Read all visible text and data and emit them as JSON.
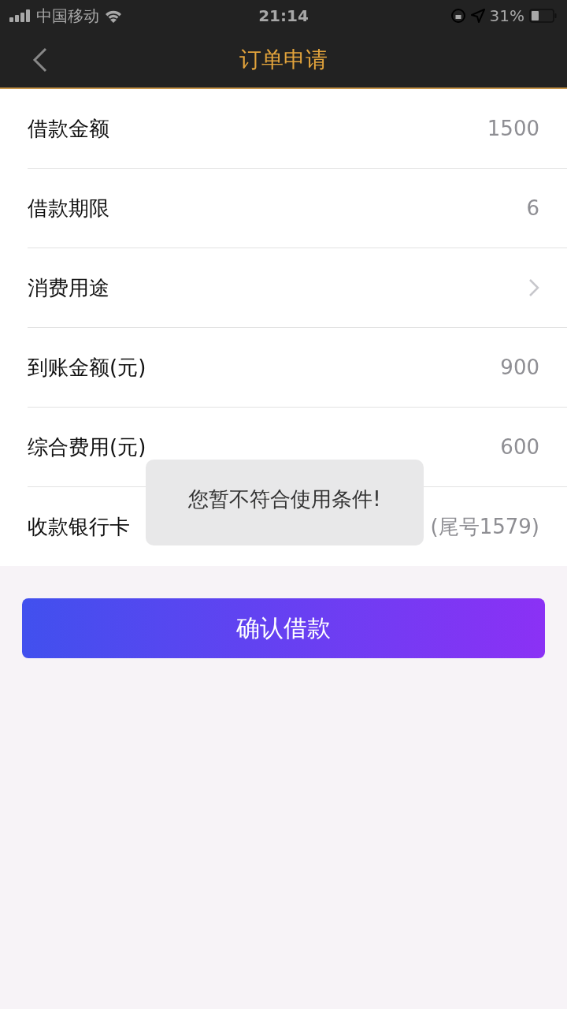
{
  "status_bar": {
    "carrier": "中国移动",
    "time": "21:14",
    "battery": "31%"
  },
  "nav": {
    "title": "订单申请"
  },
  "rows": [
    {
      "kind": "value",
      "label": "借款金额",
      "value": "1500"
    },
    {
      "kind": "value",
      "label": "借款期限",
      "value": "6"
    },
    {
      "kind": "chevron",
      "label": "消费用途"
    },
    {
      "kind": "value",
      "label": "到账金额(元)",
      "value": "900"
    },
    {
      "kind": "value",
      "label": "综合费用(元)",
      "value": "600"
    },
    {
      "kind": "value",
      "label": "收款银行卡",
      "value": "(尾号1579)"
    }
  ],
  "confirm_button": {
    "label": "确认借款"
  },
  "toast": {
    "message": "您暂不符合使用条件!"
  }
}
